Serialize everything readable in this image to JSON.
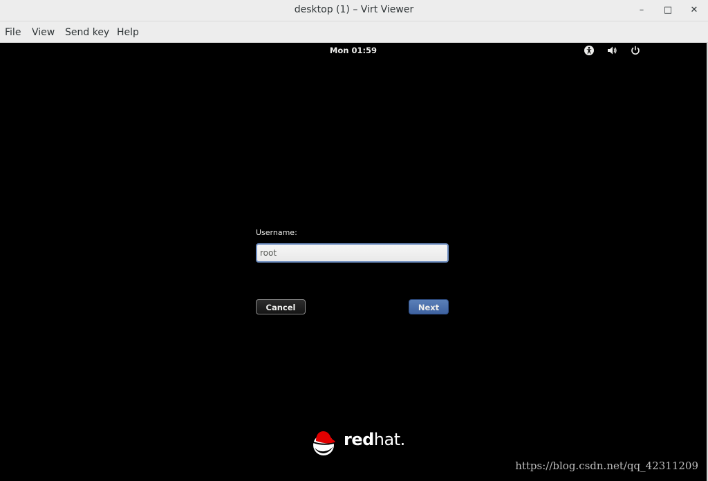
{
  "window": {
    "title": "desktop (1) – Virt Viewer"
  },
  "menu": [
    "File",
    "View",
    "Send key",
    "Help"
  ],
  "topbar": {
    "clock": "Mon 01:59",
    "icons": [
      "accessibility-icon",
      "volume-icon",
      "power-icon"
    ]
  },
  "login": {
    "username_label": "Username:",
    "username_value": "root",
    "cancel_label": "Cancel",
    "next_label": "Next"
  },
  "brand": {
    "part1": "red",
    "part2": "hat",
    "symbol": "."
  },
  "watermark": "https://blog.csdn.net/qq_42311209",
  "colors": {
    "accent": "#4a6fae",
    "logo_red": "#e00000"
  }
}
